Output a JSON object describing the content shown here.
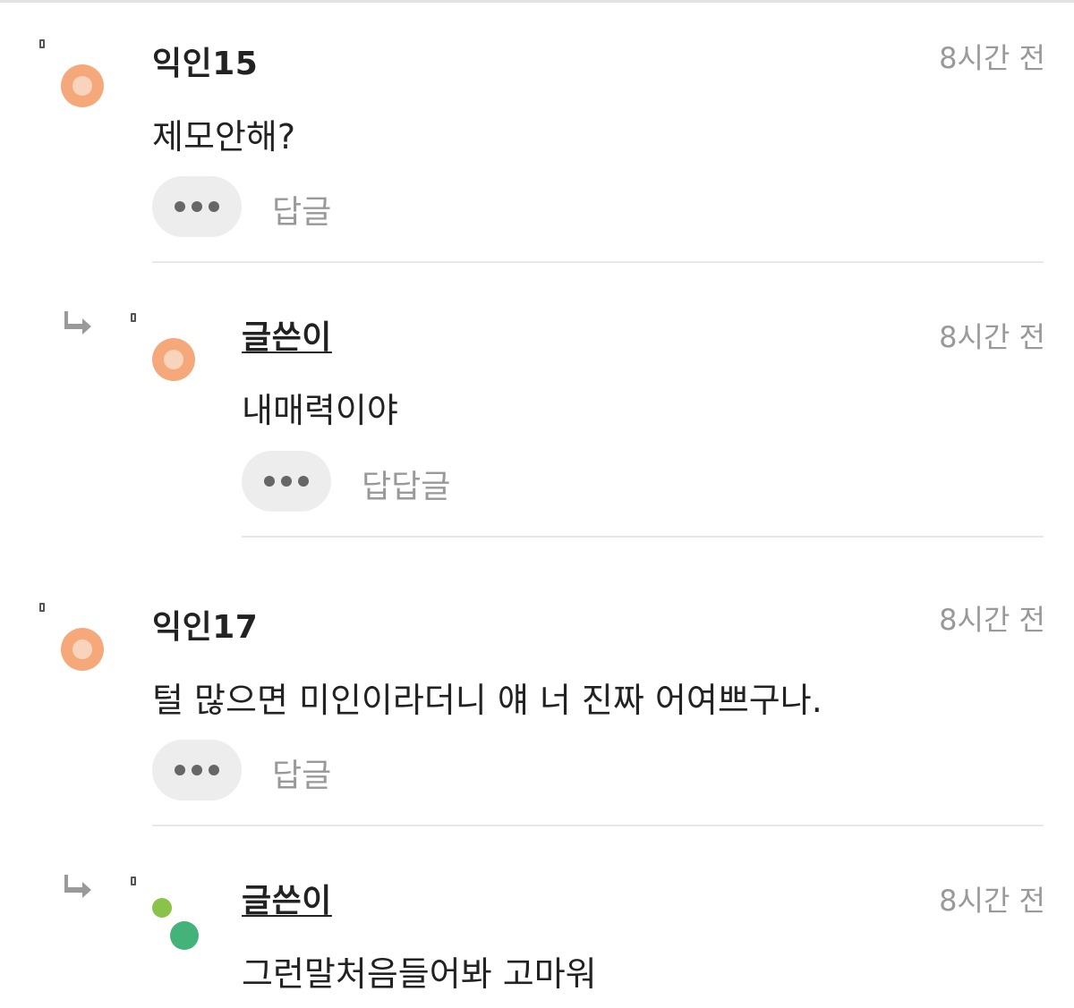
{
  "comments": [
    {
      "author": "익인15",
      "time": "8시간 전",
      "text": "제모안해?",
      "reply_label": "답글",
      "is_reply": false,
      "avatar": "orange-ring-avatar"
    },
    {
      "author": "글쓴이",
      "time": "8시간 전",
      "text": "내매력이야",
      "reply_label": "답답글",
      "is_reply": true,
      "avatar": "orange-ring-avatar"
    },
    {
      "author": "익인17",
      "time": "8시간 전",
      "text": "털 많으면 미인이라더니 얘 너 진짜 어여쁘구나.",
      "reply_label": "답글",
      "is_reply": false,
      "avatar": "orange-ring-avatar"
    },
    {
      "author": "글쓴이",
      "time": "8시간 전",
      "text": "그런말처음들어봐 고마워",
      "is_reply": true,
      "avatar": "green-dots-avatar"
    }
  ],
  "icons": {
    "more": "more-dots-icon",
    "reply_arrow": "reply-arrow-icon",
    "marker": "marker-icon"
  },
  "colors": {
    "avatar_orange": "#f5a97a",
    "avatar_green_light": "#8bc34a",
    "avatar_green_dark": "#43b37a",
    "muted_text": "#999999",
    "button_bg": "#ededed"
  }
}
